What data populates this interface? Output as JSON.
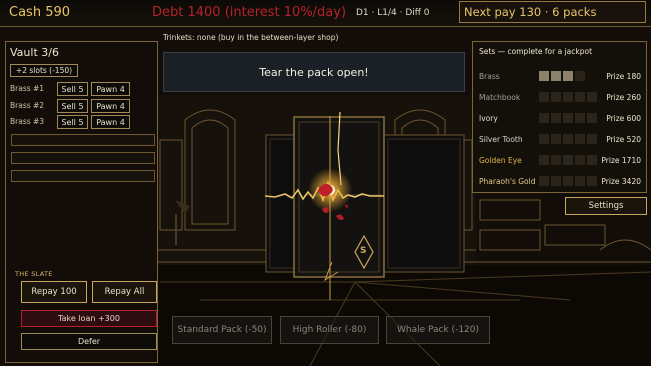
{
  "top": {
    "cash": "Cash 590",
    "debt": "Debt 1400 (interest 10%/day)",
    "depth": "D1 · L1/4 · Diff 0",
    "next_pay": "Next pay 130 · 6 packs"
  },
  "trinkets": "Trinkets: none (buy in the between-layer shop)",
  "vault": {
    "title": "Vault 3/6",
    "slots_button": "+2 slots (-150)",
    "items": [
      {
        "label": "Brass #1",
        "sell": "Sell 5",
        "pawn": "Pawn 4"
      },
      {
        "label": "Brass #2",
        "sell": "Sell 5",
        "pawn": "Pawn 4"
      },
      {
        "label": "Brass #3",
        "sell": "Sell 5",
        "pawn": "Pawn 4"
      }
    ]
  },
  "slate": {
    "title": "THE SLATE",
    "repay100": "Repay 100",
    "repay_all": "Repay All",
    "loan": "Take loan +300",
    "defer": "Defer"
  },
  "banner": "Tear the pack open!",
  "card_rank": "S",
  "sets": {
    "title": "Sets — complete for a jackpot",
    "rows": [
      {
        "name": "Brass",
        "prize": "Prize 180",
        "color": "#a59f93",
        "filled": 3,
        "total": 4
      },
      {
        "name": "Matchbook",
        "prize": "Prize 260",
        "color": "#a59f93",
        "filled": 0,
        "total": 5
      },
      {
        "name": "Ivory",
        "prize": "Prize 600",
        "color": "#e5dfcf",
        "filled": 0,
        "total": 5
      },
      {
        "name": "Silver Tooth",
        "prize": "Prize 520",
        "color": "#dad5c9",
        "filled": 0,
        "total": 5
      },
      {
        "name": "Golden Eye",
        "prize": "Prize 1710",
        "color": "#e3b44c",
        "filled": 0,
        "total": 5
      },
      {
        "name": "Pharaoh's Gold",
        "prize": "Prize 3420",
        "color": "#e6c98a",
        "filled": 0,
        "total": 5
      }
    ]
  },
  "settings": "Settings",
  "packs": {
    "standard": "Standard Pack (-50)",
    "high_roller": "High Roller (-80)",
    "whale": "Whale Pack (-120)"
  }
}
